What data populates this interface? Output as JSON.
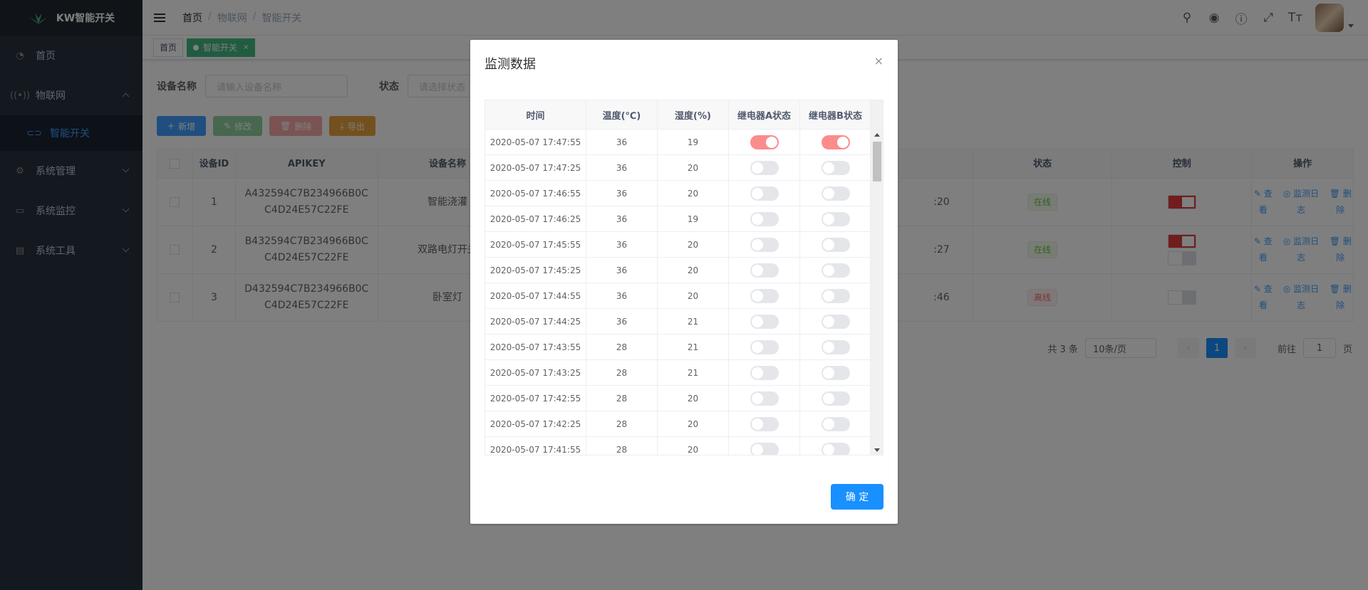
{
  "app": {
    "title": "KW智能开关"
  },
  "sidebar": {
    "items": [
      {
        "label": "首页",
        "icon": "dashboard-icon"
      },
      {
        "label": "物联网",
        "icon": "iot-icon"
      },
      {
        "label": "智能开关",
        "icon": "switch-icon"
      },
      {
        "label": "系统管理",
        "icon": "settings-icon"
      },
      {
        "label": "系统监控",
        "icon": "monitor-icon"
      },
      {
        "label": "系统工具",
        "icon": "toolbox-icon"
      }
    ]
  },
  "breadcrumb": [
    "首页",
    "物联网",
    "智能开关"
  ],
  "tags": {
    "home": "首页",
    "active": "智能开关"
  },
  "search": {
    "name_label": "设备名称",
    "name_placeholder": "请输入设备名称",
    "status_label": "状态",
    "status_placeholder": "请选择状态"
  },
  "toolbar": {
    "add": "新增",
    "edit": "修改",
    "delete": "删除",
    "export": "导出"
  },
  "device_table": {
    "headers": {
      "id": "设备ID",
      "apikey": "APIKEY",
      "name": "设备名称",
      "status": "状态",
      "control": "控制",
      "ops": "操作"
    },
    "rows": [
      {
        "id": "1",
        "apikey": "A432594C7B234966B0CC4D24E57C22FE",
        "name": "智能浇灌",
        "time_tail": ":20",
        "status": "在线"
      },
      {
        "id": "2",
        "apikey": "B432594C7B234966B0CC4D24E57C22FE",
        "name": "双路电灯开关",
        "time_tail": ":27",
        "status": "在线"
      },
      {
        "id": "3",
        "apikey": "D432594C7B234966B0CC4D24E57C22FE",
        "name": "卧室灯",
        "time_tail": ":46",
        "status": "离线"
      }
    ],
    "ops": {
      "view": "查看",
      "log": "监测日志",
      "delete": "删除"
    }
  },
  "pager": {
    "total": "共 3 条",
    "page_size": "10条/页",
    "current": "1",
    "goto_label": "前往",
    "goto_value": "1",
    "page_suffix": "页"
  },
  "dialog": {
    "title": "监测数据",
    "close": "×",
    "headers": {
      "time": "时间",
      "temp": "温度(℃)",
      "humidity": "湿度(%)",
      "relay_a": "继电器A状态",
      "relay_b": "继电器B状态"
    },
    "rows": [
      {
        "time": "2020-05-07 17:47:55",
        "temp": "36",
        "humidity": "19",
        "a": true,
        "b": true
      },
      {
        "time": "2020-05-07 17:47:25",
        "temp": "36",
        "humidity": "20",
        "a": false,
        "b": false
      },
      {
        "time": "2020-05-07 17:46:55",
        "temp": "36",
        "humidity": "20",
        "a": false,
        "b": false
      },
      {
        "time": "2020-05-07 17:46:25",
        "temp": "36",
        "humidity": "19",
        "a": false,
        "b": false
      },
      {
        "time": "2020-05-07 17:45:55",
        "temp": "36",
        "humidity": "20",
        "a": false,
        "b": false
      },
      {
        "time": "2020-05-07 17:45:25",
        "temp": "36",
        "humidity": "20",
        "a": false,
        "b": false
      },
      {
        "time": "2020-05-07 17:44:55",
        "temp": "36",
        "humidity": "20",
        "a": false,
        "b": false
      },
      {
        "time": "2020-05-07 17:44:25",
        "temp": "36",
        "humidity": "21",
        "a": false,
        "b": false
      },
      {
        "time": "2020-05-07 17:43:55",
        "temp": "28",
        "humidity": "21",
        "a": false,
        "b": false
      },
      {
        "time": "2020-05-07 17:43:25",
        "temp": "28",
        "humidity": "21",
        "a": false,
        "b": false
      },
      {
        "time": "2020-05-07 17:42:55",
        "temp": "28",
        "humidity": "20",
        "a": false,
        "b": false
      },
      {
        "time": "2020-05-07 17:42:25",
        "temp": "28",
        "humidity": "20",
        "a": false,
        "b": false
      },
      {
        "time": "2020-05-07 17:41:55",
        "temp": "28",
        "humidity": "20",
        "a": false,
        "b": false
      }
    ],
    "ok_label": "确 定"
  },
  "colors": {
    "accent": "#409eff",
    "active_tag": "#42b983",
    "switch_on": "#fb8c8c",
    "sidebar_bg": "#28303f"
  }
}
